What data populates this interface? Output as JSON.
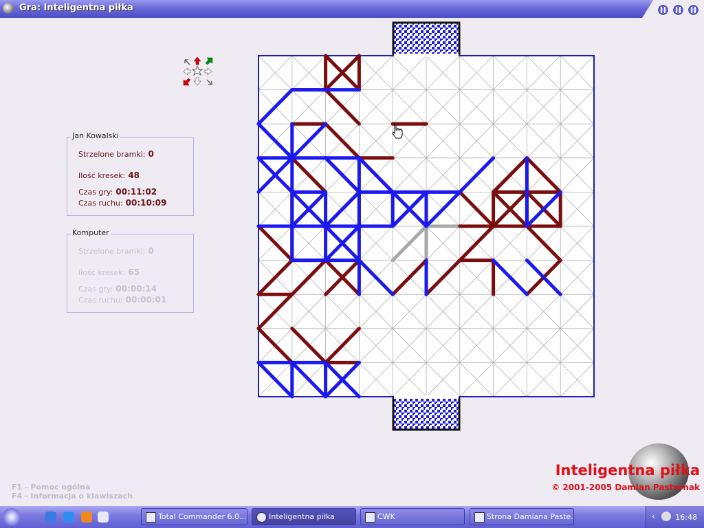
{
  "window": {
    "title": "Gra: Inteligentna piłka"
  },
  "player1": {
    "name": "Jan Kowalski",
    "goals_label": "Strzelone bramki:",
    "goals": "0",
    "lines_label": "Ilość kresek:",
    "lines": "48",
    "game_time_label": "Czas gry:",
    "game_time": "00:11:02",
    "move_time_label": "Czas ruchu:",
    "move_time": "00:10:09"
  },
  "player2": {
    "name": "Komputer",
    "goals_label": "Strzelone bramki:",
    "goals": "0",
    "lines_label": "Ilość kresek:",
    "lines": "65",
    "game_time_label": "Czas gry:",
    "game_time": "00:00:14",
    "move_time_label": "Czas ruchu:",
    "move_time": "00:00:01"
  },
  "help": {
    "f1": "F1 - Pomoc ogólna",
    "f4": "F4 - Informacja o klawiszach"
  },
  "branding": {
    "title": "Inteligentna piłka",
    "copyright": "© 2001-2005 Damian Pasternak"
  },
  "colors": {
    "player": "#1a1af0",
    "computer": "#7a0d0d",
    "preview": "#a8a8a8",
    "grid": "#b0b0b8",
    "border": "#1d1db0"
  },
  "board": {
    "cols": 10,
    "rows": 10,
    "goal_cols": [
      4,
      6
    ],
    "blue_moves": [
      [
        [
          2,
          1
        ],
        [
          3,
          1
        ]
      ],
      [
        [
          0,
          2
        ],
        [
          1,
          1
        ]
      ],
      [
        [
          1,
          1
        ],
        [
          2,
          1
        ]
      ],
      [
        [
          0,
          2
        ],
        [
          1,
          3
        ]
      ],
      [
        [
          1,
          3
        ],
        [
          2,
          2
        ]
      ],
      [
        [
          1,
          2
        ],
        [
          1,
          6
        ]
      ],
      [
        [
          0,
          3
        ],
        [
          1,
          3
        ]
      ],
      [
        [
          1,
          3
        ],
        [
          2,
          3
        ]
      ],
      [
        [
          2,
          3
        ],
        [
          3,
          3
        ]
      ],
      [
        [
          0,
          3
        ],
        [
          1,
          4
        ]
      ],
      [
        [
          1,
          3
        ],
        [
          0,
          4
        ]
      ],
      [
        [
          2,
          3
        ],
        [
          3,
          4
        ]
      ],
      [
        [
          3,
          3
        ],
        [
          4,
          4
        ]
      ],
      [
        [
          1,
          4
        ],
        [
          2,
          5
        ]
      ],
      [
        [
          2,
          5
        ],
        [
          3,
          4
        ]
      ],
      [
        [
          0,
          5
        ],
        [
          1,
          5
        ]
      ],
      [
        [
          1,
          5
        ],
        [
          4,
          5
        ]
      ],
      [
        [
          2,
          4
        ],
        [
          2,
          6
        ]
      ],
      [
        [
          3,
          4
        ],
        [
          3,
          5
        ]
      ],
      [
        [
          3,
          3
        ],
        [
          3,
          5
        ]
      ],
      [
        [
          1,
          4
        ],
        [
          2,
          4
        ]
      ],
      [
        [
          2,
          4
        ],
        [
          1,
          5
        ]
      ],
      [
        [
          1,
          6
        ],
        [
          3,
          6
        ]
      ],
      [
        [
          2,
          6
        ],
        [
          3,
          5
        ]
      ],
      [
        [
          2,
          5
        ],
        [
          3,
          6
        ]
      ],
      [
        [
          3,
          6
        ],
        [
          4,
          7
        ]
      ],
      [
        [
          3,
          5
        ],
        [
          3,
          7
        ]
      ],
      [
        [
          3,
          4
        ],
        [
          6,
          4
        ]
      ],
      [
        [
          4,
          4
        ],
        [
          4,
          5
        ]
      ],
      [
        [
          4,
          5
        ],
        [
          5,
          4
        ]
      ],
      [
        [
          4,
          4
        ],
        [
          5,
          5
        ]
      ],
      [
        [
          5,
          4
        ],
        [
          5,
          5
        ]
      ],
      [
        [
          5,
          5
        ],
        [
          6,
          4
        ]
      ],
      [
        [
          6,
          4
        ],
        [
          7,
          3
        ]
      ],
      [
        [
          5,
          4
        ],
        [
          5,
          5
        ]
      ],
      [
        [
          5,
          6
        ],
        [
          5,
          7
        ]
      ],
      [
        [
          7,
          6
        ],
        [
          8,
          7
        ]
      ],
      [
        [
          8,
          6
        ],
        [
          9,
          7
        ]
      ],
      [
        [
          8,
          4
        ],
        [
          8,
          5
        ]
      ],
      [
        [
          8,
          5
        ],
        [
          9,
          4
        ]
      ],
      [
        [
          8,
          3
        ],
        [
          8,
          5
        ]
      ],
      [
        [
          0,
          9
        ],
        [
          1,
          9
        ]
      ],
      [
        [
          1,
          9
        ],
        [
          2,
          9
        ]
      ],
      [
        [
          0,
          9
        ],
        [
          1,
          10
        ]
      ],
      [
        [
          1,
          9
        ],
        [
          1,
          10
        ]
      ],
      [
        [
          1,
          9
        ],
        [
          2,
          10
        ]
      ],
      [
        [
          2,
          9
        ],
        [
          3,
          10
        ]
      ],
      [
        [
          3,
          9
        ],
        [
          2,
          10
        ]
      ],
      [
        [
          2,
          9
        ],
        [
          2,
          10
        ]
      ]
    ],
    "red_moves": [
      [
        [
          2,
          0
        ],
        [
          3,
          1
        ]
      ],
      [
        [
          3,
          0
        ],
        [
          2,
          1
        ]
      ],
      [
        [
          2,
          0
        ],
        [
          2,
          1
        ]
      ],
      [
        [
          3,
          0
        ],
        [
          3,
          1
        ]
      ],
      [
        [
          1,
          1
        ],
        [
          2,
          1
        ]
      ],
      [
        [
          2,
          1
        ],
        [
          3,
          2
        ]
      ],
      [
        [
          1,
          2
        ],
        [
          2,
          2
        ]
      ],
      [
        [
          2,
          2
        ],
        [
          3,
          3
        ]
      ],
      [
        [
          3,
          3
        ],
        [
          4,
          3
        ]
      ],
      [
        [
          1,
          3
        ],
        [
          2,
          4
        ]
      ],
      [
        [
          2,
          3
        ],
        [
          3,
          4
        ]
      ],
      [
        [
          3,
          4
        ],
        [
          2,
          5
        ]
      ],
      [
        [
          2,
          4
        ],
        [
          1,
          5
        ]
      ],
      [
        [
          1,
          4
        ],
        [
          1,
          6
        ]
      ],
      [
        [
          0,
          5
        ],
        [
          1,
          5
        ]
      ],
      [
        [
          0,
          5
        ],
        [
          1,
          6
        ]
      ],
      [
        [
          1,
          6
        ],
        [
          0,
          7
        ]
      ],
      [
        [
          1,
          6
        ],
        [
          2,
          6
        ]
      ],
      [
        [
          2,
          6
        ],
        [
          3,
          7
        ]
      ],
      [
        [
          3,
          6
        ],
        [
          2,
          7
        ]
      ],
      [
        [
          2,
          6
        ],
        [
          1,
          7
        ]
      ],
      [
        [
          1,
          7
        ],
        [
          0,
          7
        ]
      ],
      [
        [
          0,
          8
        ],
        [
          1,
          7
        ]
      ],
      [
        [
          0,
          8
        ],
        [
          1,
          9
        ]
      ],
      [
        [
          1,
          8
        ],
        [
          2,
          9
        ]
      ],
      [
        [
          2,
          9
        ],
        [
          3,
          8
        ]
      ],
      [
        [
          2,
          9
        ],
        [
          3,
          9
        ]
      ],
      [
        [
          3,
          3
        ],
        [
          4,
          4
        ]
      ],
      [
        [
          4,
          5
        ],
        [
          5,
          4
        ]
      ],
      [
        [
          4,
          7
        ],
        [
          5,
          6
        ]
      ],
      [
        [
          5,
          7
        ],
        [
          6,
          6
        ]
      ],
      [
        [
          6,
          6
        ],
        [
          7,
          6
        ]
      ],
      [
        [
          6,
          6
        ],
        [
          7,
          5
        ]
      ],
      [
        [
          6,
          5
        ],
        [
          7,
          5
        ]
      ],
      [
        [
          6,
          4
        ],
        [
          7,
          5
        ]
      ],
      [
        [
          7,
          5
        ],
        [
          8,
          4
        ]
      ],
      [
        [
          8,
          4
        ],
        [
          9,
          5
        ]
      ],
      [
        [
          7,
          4
        ],
        [
          8,
          4
        ]
      ],
      [
        [
          7,
          4
        ],
        [
          8,
          3
        ]
      ],
      [
        [
          7,
          5
        ],
        [
          9,
          5
        ]
      ],
      [
        [
          7,
          4
        ],
        [
          7,
          5
        ]
      ],
      [
        [
          7,
          6
        ],
        [
          7,
          7
        ]
      ],
      [
        [
          8,
          5
        ],
        [
          9,
          6
        ]
      ],
      [
        [
          9,
          6
        ],
        [
          8,
          7
        ]
      ],
      [
        [
          8,
          4
        ],
        [
          9,
          4
        ]
      ],
      [
        [
          8,
          3
        ],
        [
          7,
          4
        ]
      ],
      [
        [
          7,
          4
        ],
        [
          8,
          5
        ]
      ],
      [
        [
          8,
          3
        ],
        [
          9,
          4
        ]
      ],
      [
        [
          9,
          4
        ],
        [
          9,
          5
        ]
      ],
      [
        [
          4,
          2
        ],
        [
          5,
          2
        ]
      ]
    ],
    "preview_moves": [
      [
        [
          5,
          5
        ],
        [
          6,
          5
        ]
      ],
      [
        [
          5,
          5
        ],
        [
          5,
          6
        ]
      ],
      [
        [
          5,
          5
        ],
        [
          4,
          6
        ]
      ]
    ]
  }
}
